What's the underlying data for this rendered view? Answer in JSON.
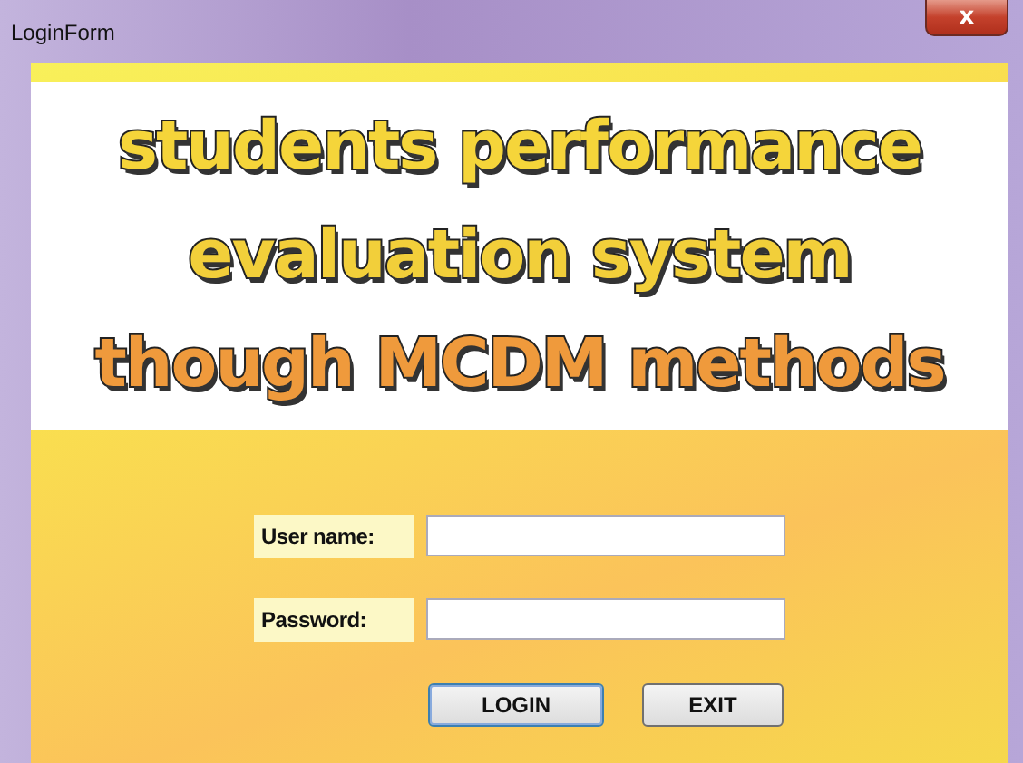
{
  "window": {
    "title": "LoginForm",
    "close": "x"
  },
  "banner": {
    "lines": [
      {
        "text": "students performance",
        "color": "#f5d53a"
      },
      {
        "text": "evaluation system",
        "color": "#f2cf3a"
      },
      {
        "text": "though MCDM methods",
        "color": "#ef9a3c"
      }
    ]
  },
  "form": {
    "fields": [
      {
        "label": "User name:"
      },
      {
        "label": "Password:"
      }
    ],
    "buttons": [
      {
        "label": "LOGIN",
        "focused": true
      },
      {
        "label": "EXIT",
        "focused": false
      }
    ]
  }
}
